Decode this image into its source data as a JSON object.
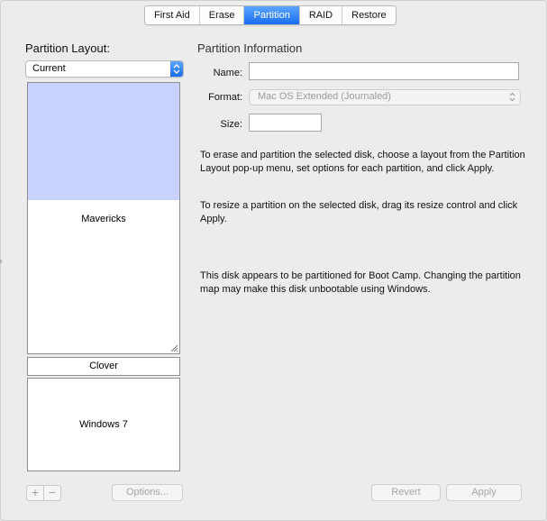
{
  "tabs": [
    {
      "label": "First Aid",
      "active": false
    },
    {
      "label": "Erase",
      "active": false
    },
    {
      "label": "Partition",
      "active": true
    },
    {
      "label": "RAID",
      "active": false
    },
    {
      "label": "Restore",
      "active": false
    }
  ],
  "left": {
    "title": "Partition Layout:",
    "layout_popup_value": "Current",
    "partitions": [
      {
        "label": "Mavericks",
        "selected": true
      },
      {
        "label": "Clover",
        "selected": false
      },
      {
        "label": "Windows 7",
        "selected": false
      }
    ],
    "add_label": "+",
    "remove_label": "−",
    "options_label": "Options..."
  },
  "right": {
    "title": "Partition Information",
    "name_label": "Name:",
    "name_value": "",
    "format_label": "Format:",
    "format_value": "Mac OS Extended (Journaled)",
    "size_label": "Size:",
    "size_value": "",
    "instructions": [
      "To erase and partition the selected disk, choose a layout from the Partition Layout pop-up menu, set options for each partition, and click Apply.",
      "To resize a partition on the selected disk, drag its resize control and click Apply.",
      "This disk appears to be partitioned for Boot Camp. Changing the partition map may make this disk unbootable using Windows."
    ],
    "revert_label": "Revert",
    "apply_label": "Apply"
  },
  "colors": {
    "accent": "#1a6df0",
    "selection": "#c8d1ff"
  }
}
